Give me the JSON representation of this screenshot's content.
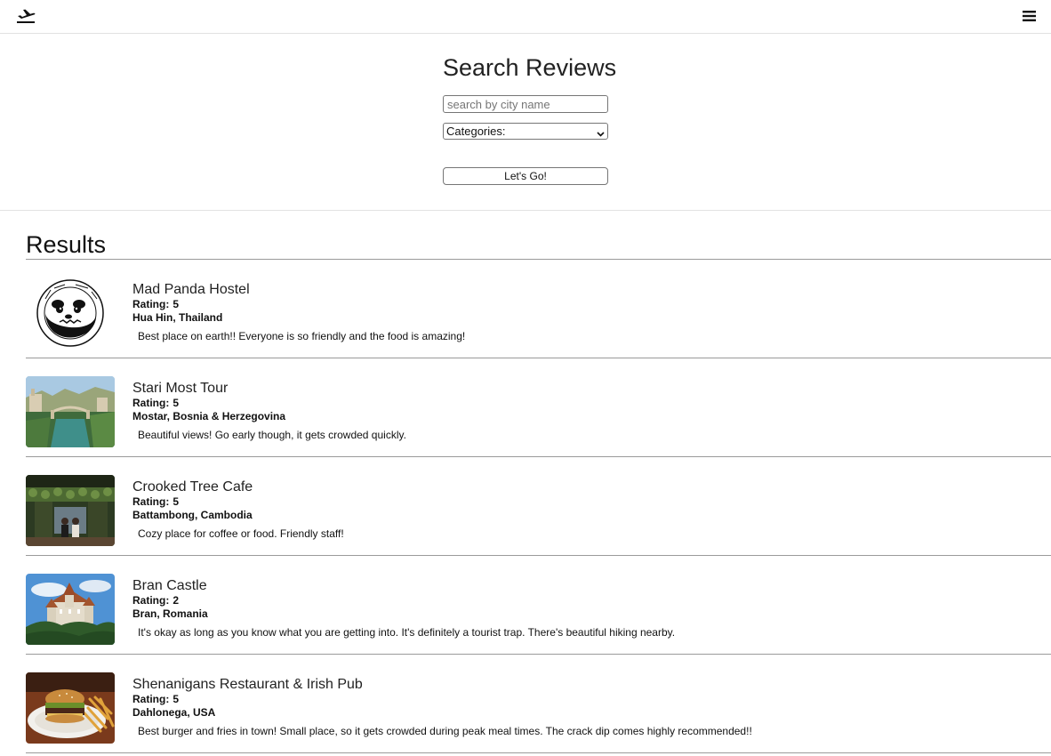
{
  "navbar": {
    "logo_icon": "airplane-departure-icon",
    "menu_icon": "hamburger-menu-icon"
  },
  "search": {
    "title": "Search Reviews",
    "city_placeholder": "search by city name",
    "category_selected": "Categories:",
    "submit_label": "Let's Go!"
  },
  "results": {
    "title": "Results",
    "rating_label": "Rating:",
    "items": [
      {
        "name": "Mad Panda Hostel",
        "rating": "5",
        "location": "Hua Hin, Thailand",
        "review": "Best place on earth!! Everyone is so friendly and the food is amazing!",
        "image": "mad-panda-hostel-logo"
      },
      {
        "name": "Stari Most Tour",
        "rating": "5",
        "location": "Mostar, Bosnia & Herzegovina",
        "review": "Beautiful views! Go early though, it gets crowded quickly.",
        "image": "stari-most-bridge-photo"
      },
      {
        "name": "Crooked Tree Cafe",
        "rating": "5",
        "location": "Battambong, Cambodia",
        "review": "Cozy place for coffee or food. Friendly staff!",
        "image": "crooked-tree-cafe-photo"
      },
      {
        "name": "Bran Castle",
        "rating": "2",
        "location": "Bran, Romania",
        "review": "It's okay as long as you know what you are getting into. It's definitely a tourist trap. There's beautiful hiking nearby.",
        "image": "bran-castle-photo"
      },
      {
        "name": "Shenanigans Restaurant & Irish Pub",
        "rating": "5",
        "location": "Dahlonega, USA",
        "review": "Best burger and fries in town! Small place, so it gets crowded during peak meal times. The crack dip comes highly recommended!!",
        "image": "burger-and-fries-photo"
      }
    ]
  }
}
